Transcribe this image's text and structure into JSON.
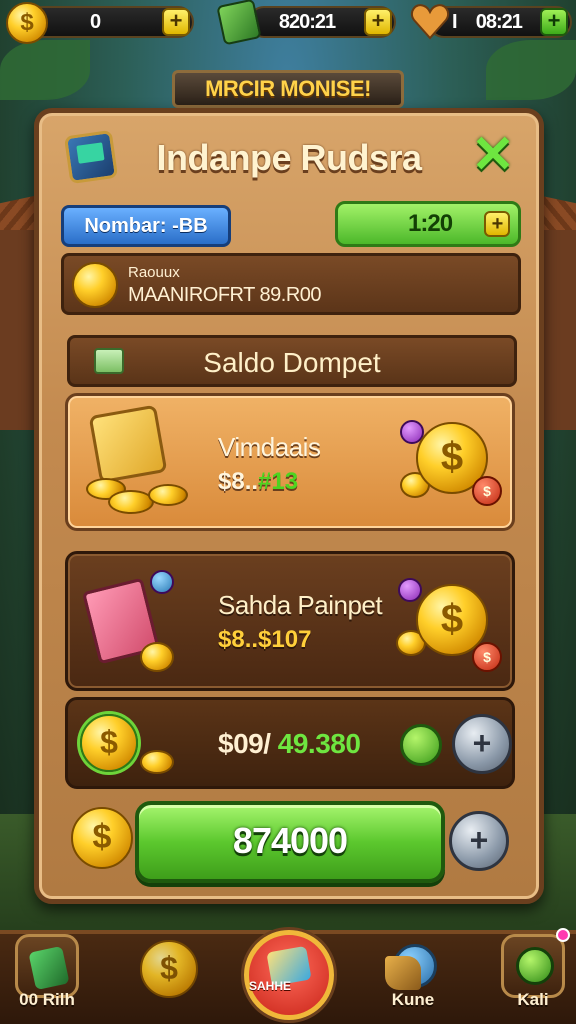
{
  "hud": {
    "coins": "0",
    "currency_timer": "820:21",
    "lives_timer": "08:21",
    "lives_prefix": "I"
  },
  "banner": "MRCIR MONISE!",
  "panel": {
    "title": "Indanpe Rudsra",
    "number_badge": "Nombar: -BB",
    "green_value": "1:20",
    "info_label": "Raouux",
    "info_value": "MAANIROFRT 89.R00",
    "section_title": "Saldo Dompet"
  },
  "cards": [
    {
      "name": "Vimdaais",
      "amount_main": "$8..",
      "amount_accent": "#13"
    },
    {
      "name": "Sahda Painpet",
      "amount_main": "$8..$107",
      "amount_accent": ""
    }
  ],
  "balance": {
    "amount_main": "$09/",
    "amount_accent": "49.380"
  },
  "action_button": "874000",
  "bottom_nav": [
    {
      "label": "00 Rilh"
    },
    {
      "label": ""
    },
    {
      "label": "SAHHE"
    },
    {
      "label": "Kune"
    },
    {
      "label": "Kali"
    }
  ],
  "colors": {
    "accent_green": "#5cc82e",
    "panel_wood": "#c38a4f",
    "gold": "#ffcf2a",
    "badge_blue": "#2a6ec8"
  },
  "icons": {
    "coin": "dollar-coin-icon",
    "gem": "green-gem-icon",
    "heart": "heart-icon",
    "close": "close-icon",
    "plus": "plus-icon"
  }
}
